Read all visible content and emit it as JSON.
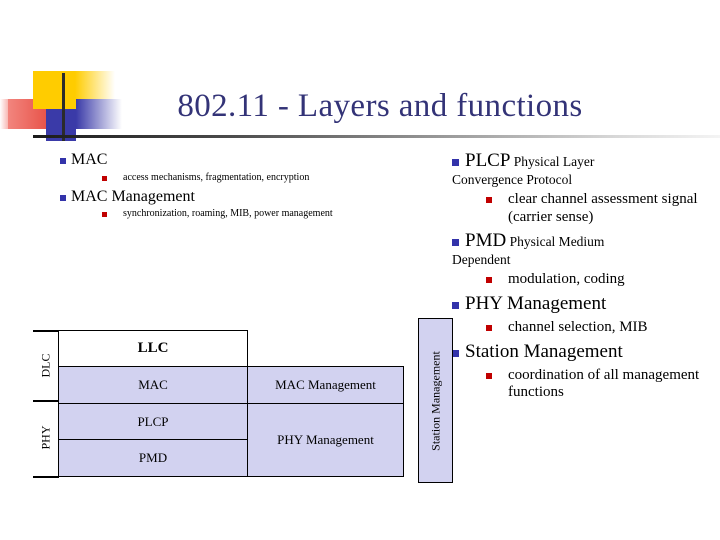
{
  "slide": {
    "title": "802.11 - Layers and functions",
    "accent_title_color": "#333377",
    "bullet_color": "#3333AA",
    "subbullet_color": "#C00000",
    "cell_fill": "#D2D2F0"
  },
  "left_column": [
    {
      "heading": "MAC",
      "heading_small": "",
      "continuation": "",
      "subbullets": [
        "access mechanisms, fragmentation, encryption"
      ]
    },
    {
      "heading": "MAC Management",
      "heading_small": "",
      "continuation": "",
      "subbullets": [
        "synchronization, roaming, MIB, power management"
      ]
    }
  ],
  "right_column": [
    {
      "heading": "PLCP",
      "heading_small": "Physical Layer",
      "continuation": "Convergence Protocol",
      "subbullets": [
        "clear channel assessment signal (carrier sense)"
      ]
    },
    {
      "heading": "PMD",
      "heading_small": "Physical Medium",
      "continuation": "Dependent",
      "subbullets": [
        "modulation, coding"
      ]
    },
    {
      "heading": "PHY Management",
      "heading_small": "",
      "continuation": "",
      "subbullets": [
        "channel selection, MIB"
      ]
    },
    {
      "heading": "Station Management",
      "heading_small": "",
      "continuation": "",
      "subbullets": [
        "coordination of all management functions"
      ]
    }
  ],
  "diagram": {
    "station_management": "Station Management",
    "side_labels": [
      "DLC",
      "PHY"
    ],
    "cells": {
      "llc": "LLC",
      "mac": "MAC",
      "plcp": "PLCP",
      "pmd": "PMD",
      "mac_management": "MAC Management",
      "phy_management": "PHY Management"
    }
  }
}
